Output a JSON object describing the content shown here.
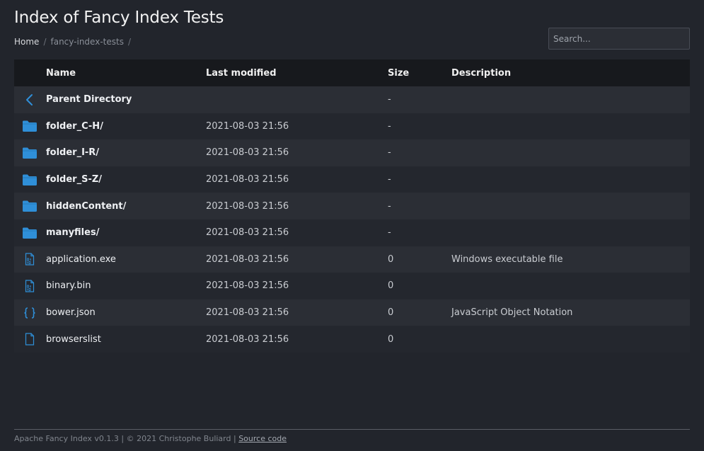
{
  "page": {
    "title": "Index of Fancy Index Tests"
  },
  "breadcrumb": {
    "home": "Home",
    "sep1": "/",
    "current": "fancy-index-tests",
    "sep2": "/"
  },
  "search": {
    "placeholder": "Search..."
  },
  "table": {
    "headers": {
      "name": "Name",
      "modified": "Last modified",
      "size": "Size",
      "description": "Description"
    },
    "rows": [
      {
        "icon": "back-chevron-icon",
        "name": "Parent Directory",
        "modified": "",
        "size": "-",
        "description": ""
      },
      {
        "icon": "folder-icon",
        "name": "folder_C-H/",
        "modified": "2021-08-03 21:56",
        "size": "-",
        "description": ""
      },
      {
        "icon": "folder-icon",
        "name": "folder_I-R/",
        "modified": "2021-08-03 21:56",
        "size": "-",
        "description": ""
      },
      {
        "icon": "folder-icon",
        "name": "folder_S-Z/",
        "modified": "2021-08-03 21:56",
        "size": "-",
        "description": ""
      },
      {
        "icon": "folder-icon",
        "name": "hiddenContent/",
        "modified": "2021-08-03 21:56",
        "size": "-",
        "description": ""
      },
      {
        "icon": "folder-icon",
        "name": "manyfiles/",
        "modified": "2021-08-03 21:56",
        "size": "-",
        "description": ""
      },
      {
        "icon": "binary-file-icon",
        "name": "application.exe",
        "modified": "2021-08-03 21:56",
        "size": "0",
        "description": "Windows executable file"
      },
      {
        "icon": "binary-file-icon",
        "name": "binary.bin",
        "modified": "2021-08-03 21:56",
        "size": "0",
        "description": ""
      },
      {
        "icon": "json-braces-icon",
        "name": "bower.json",
        "modified": "2021-08-03 21:56",
        "size": "0",
        "description": "JavaScript Object Notation"
      },
      {
        "icon": "file-icon",
        "name": "browserslist",
        "modified": "2021-08-03 21:56",
        "size": "0",
        "description": ""
      }
    ]
  },
  "footer": {
    "text": "Apache Fancy Index v0.1.3 | © 2021 Christophe Buliard |",
    "link": "Source code"
  },
  "colors": {
    "background": "#22252c",
    "header_row": "#17191d",
    "row_odd": "#2b2e35",
    "row_even": "#24272e",
    "icon_accent": "#2f8fd8"
  }
}
